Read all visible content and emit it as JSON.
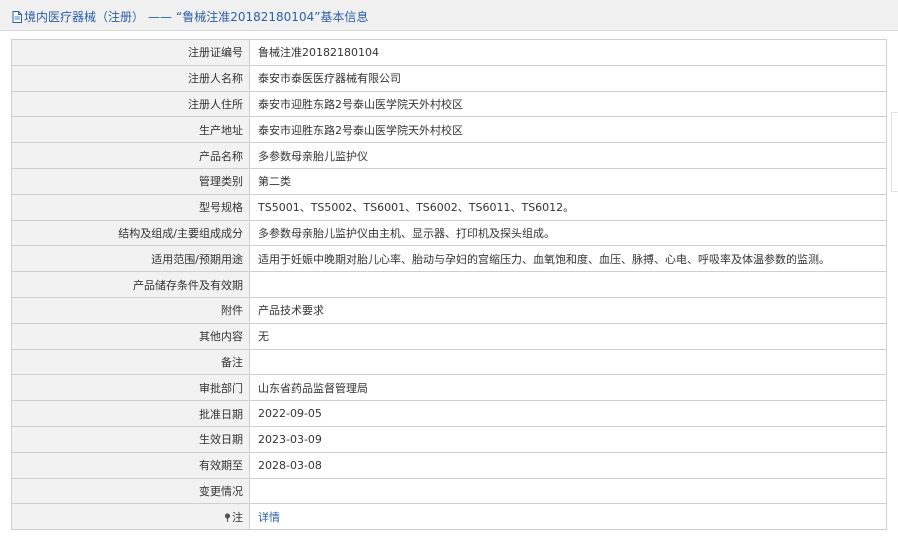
{
  "header": {
    "icon": "document-icon",
    "section": "境内医疗器械（注册）",
    "separator": "——",
    "title": "“鲁械注准20182180104”基本信息"
  },
  "rows": [
    {
      "label": "注册证编号",
      "value": "鲁械注准20182180104"
    },
    {
      "label": "注册人名称",
      "value": "泰安市泰医医疗器械有限公司"
    },
    {
      "label": "注册人住所",
      "value": "泰安市迎胜东路2号泰山医学院天外村校区"
    },
    {
      "label": "生产地址",
      "value": "泰安市迎胜东路2号泰山医学院天外村校区"
    },
    {
      "label": "产品名称",
      "value": "多参数母亲胎儿监护仪"
    },
    {
      "label": "管理类别",
      "value": "第二类"
    },
    {
      "label": "型号规格",
      "value": "TS5001、TS5002、TS6001、TS6002、TS6011、TS6012。"
    },
    {
      "label": "结构及组成/主要组成成分",
      "value": "多参数母亲胎儿监护仪由主机、显示器、打印机及探头组成。"
    },
    {
      "label": "适用范围/预期用途",
      "value": "适用于妊娠中晚期对胎儿心率、胎动与孕妇的宫缩压力、血氧饱和度、血压、脉搏、心电、呼吸率及体温参数的监测。"
    },
    {
      "label": "产品储存条件及有效期",
      "value": ""
    },
    {
      "label": "附件",
      "value": "产品技术要求"
    },
    {
      "label": "其他内容",
      "value": "无"
    },
    {
      "label": "备注",
      "value": ""
    },
    {
      "label": "审批部门",
      "value": "山东省药品监督管理局"
    },
    {
      "label": "批准日期",
      "value": "2022-09-05"
    },
    {
      "label": "生效日期",
      "value": "2023-03-09"
    },
    {
      "label": "有效期至",
      "value": "2028-03-08"
    },
    {
      "label": "变更情况",
      "value": ""
    }
  ],
  "note_row": {
    "icon": "pin-icon",
    "label": "注",
    "link_text": "详情"
  },
  "colors": {
    "header_bg": "#f0f0f0",
    "label_bg": "#f2f2f2",
    "border": "#cfcfcf",
    "link": "#2b5fa6"
  }
}
